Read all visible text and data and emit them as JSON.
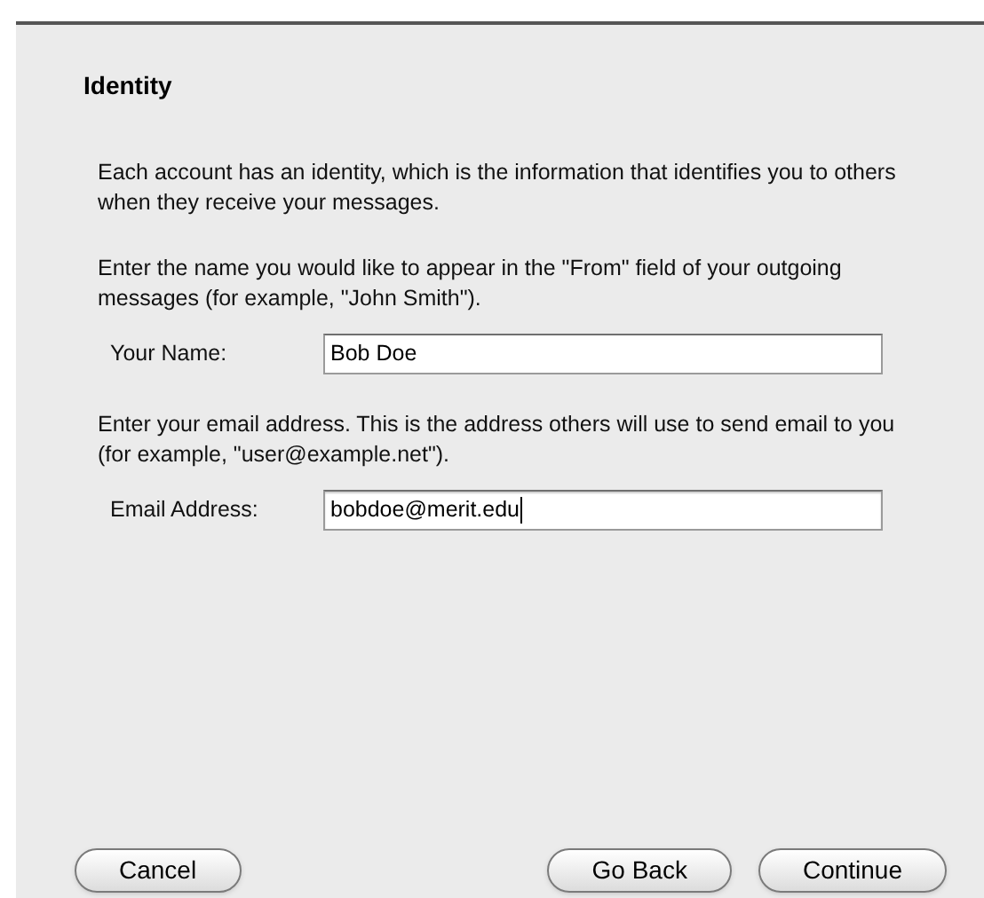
{
  "title": "Identity",
  "intro": "Each account has an identity, which is the information that identifies you to others when they receive your messages.",
  "sections": [
    {
      "description": "Enter the name you would like to appear in the \"From\" field of your outgoing messages (for example, \"John Smith\").",
      "label": "Your Name:",
      "value": "Bob Doe",
      "focused": false
    },
    {
      "description": "Enter your email address. This is the address others will use to send email to you (for example, \"user@example.net\").",
      "label": "Email Address:",
      "value": "bobdoe@merit.edu",
      "focused": true
    }
  ],
  "buttons": [
    {
      "label": "Cancel",
      "kind": "left"
    },
    {
      "label": "Go Back",
      "kind": "right"
    },
    {
      "label": "Continue",
      "kind": "right"
    }
  ]
}
